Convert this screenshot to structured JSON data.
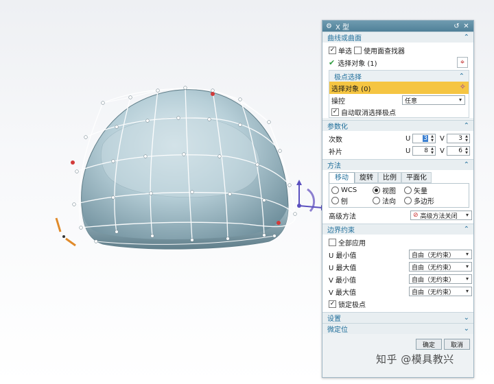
{
  "dialog": {
    "title": "X 型",
    "curve_section": {
      "title": "曲线或曲面",
      "single_label": "单选",
      "face_finder_label": "使用面查找器",
      "selected_label": "选择对象 (1)"
    },
    "pole_section": {
      "title": "极点选择",
      "select_label": "选择对象 (0)",
      "manip_label": "操控",
      "manip_value": "任意",
      "auto_deselect_label": "自动取消选择极点"
    },
    "param_section": {
      "title": "参数化",
      "degree_label": "次数",
      "patch_label": "补片",
      "u_label": "U",
      "v_label": "V",
      "degree_u": "3",
      "degree_v": "3",
      "patch_u": "8",
      "patch_v": "6"
    },
    "method_section": {
      "title": "方法",
      "tabs": [
        "移动",
        "旋转",
        "比例",
        "平面化"
      ],
      "radios": [
        "WCS",
        "视图",
        "矢量",
        "刨",
        "法向",
        "多边形"
      ],
      "advanced_label": "高级方法",
      "advanced_value": "高级方法关闭"
    },
    "boundary_section": {
      "title": "边界约束",
      "apply_all_label": "全部应用",
      "rows": [
        {
          "label": "U 最小值",
          "value": "自由（无约束）"
        },
        {
          "label": "U 最大值",
          "value": "自由（无约束）"
        },
        {
          "label": "V 最小值",
          "value": "自由（无约束）"
        },
        {
          "label": "V 最大值",
          "value": "自由（无约束）"
        }
      ],
      "lock_label": "锁定极点"
    },
    "settings_title": "设置",
    "fine_title": "微定位",
    "ok_label": "确定",
    "cancel_label": "取消"
  },
  "watermark": "知乎 @模具教兴",
  "colors": {
    "accent": "#1f6e9a",
    "selection": "#f5c542",
    "titlebar": "#5a879d",
    "surface": "#b9cfd8"
  }
}
